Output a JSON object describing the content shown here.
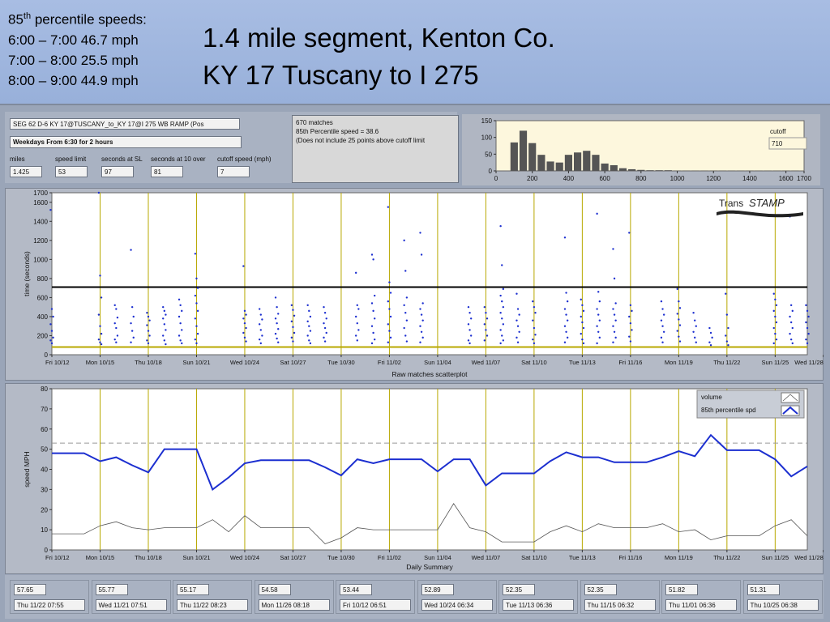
{
  "header": {
    "pct_title_base": "85",
    "pct_title_sup": "th",
    "pct_title_rest": " percentile speeds:",
    "pct_lines": [
      "6:00 – 7:00 46.7 mph",
      "7:00 – 8:00 25.5 mph",
      "8:00 – 9:00 44.9 mph"
    ],
    "title_line1": "1.4 mile segment, Kenton Co.",
    "title_line2": "KY 17   Tuscany to I 275"
  },
  "controls": {
    "segment": "SEG 62  D-6   KY 17@TUSCANY_to_KY 17@I 275 WB RAMP  (Pos",
    "period": "Weekdays   From 6:30 for  2 hours",
    "miles_label": "miles",
    "miles_value": "1.425",
    "speed_limit_label": "speed limit",
    "speed_limit_value": "53",
    "sec_sl_label": "seconds at SL",
    "sec_sl_value": "97",
    "sec_10_label": "seconds at 10 over",
    "sec_10_value": "81",
    "cutoff_label": "cutoff speed (mph)",
    "cutoff_value": "7"
  },
  "info": {
    "line1": "670 matches",
    "line2": "85th Percentile speed = 38.6",
    "line3": "(Does not include 25 points above cutoff limit"
  },
  "histogram": {
    "cutoff_label": "cutoff",
    "cutoff_value": "710"
  },
  "logo": {
    "text_a": "Trans",
    "text_b": "STAMP"
  },
  "scatter_caption": "Raw matches scatterplot",
  "scatter_ylabel": "time (seconds)",
  "daily_caption": "Daily Summary",
  "daily_ylabel": "speed MPH",
  "legend": {
    "volume": "volume",
    "pct": "85th percentile spd"
  },
  "bottom_cells": [
    {
      "value": "57.65",
      "date": "Thu 11/22  07:55"
    },
    {
      "value": "55.77",
      "date": "Wed 11/21  07:51"
    },
    {
      "value": "55.17",
      "date": "Thu 11/22  08:23"
    },
    {
      "value": "54.58",
      "date": "Mon 11/26  08:18"
    },
    {
      "value": "53.44",
      "date": "Fri 10/12  06:51"
    },
    {
      "value": "52.89",
      "date": "Wed 10/24  06:34"
    },
    {
      "value": "52.35",
      "date": "Tue 11/13  06:36"
    },
    {
      "value": "52.35",
      "date": "Thu 11/15  06:32"
    },
    {
      "value": "51.82",
      "date": "Thu 11/01  06:36"
    },
    {
      "value": "51.31",
      "date": "Thu 10/25  06:38"
    }
  ],
  "chart_data": [
    {
      "type": "bar",
      "name": "histogram",
      "xlim": [
        0,
        1700
      ],
      "ylim": [
        0,
        150
      ],
      "xticks": [
        "0",
        "200",
        "400",
        "600",
        "800",
        "1000",
        "1200",
        "1400",
        "1600",
        "1700"
      ],
      "yticks": [
        "0",
        "50",
        "100",
        "150"
      ],
      "bin_width": 50,
      "x": [
        100,
        150,
        200,
        250,
        300,
        350,
        400,
        450,
        500,
        550,
        600,
        650,
        700,
        750,
        800,
        850,
        900,
        950,
        1000,
        1050,
        1100,
        1150,
        1200,
        1250,
        1300,
        1350,
        1400,
        1450,
        1500,
        1550,
        1600,
        1650
      ],
      "values": [
        85,
        120,
        83,
        48,
        28,
        25,
        48,
        55,
        60,
        48,
        22,
        17,
        8,
        5,
        3,
        2,
        2,
        2,
        1,
        1,
        1,
        1,
        1,
        1,
        1,
        1,
        1,
        1,
        1,
        1,
        1,
        1
      ],
      "color": "#555555"
    },
    {
      "type": "scatter",
      "name": "raw-matches",
      "title": "Raw matches scatterplot",
      "ylabel": "time (seconds)",
      "xlim": [
        0,
        47
      ],
      "ylim": [
        0,
        1700
      ],
      "yticks": [
        "0",
        "200",
        "400",
        "600",
        "800",
        "1000",
        "1200",
        "1400",
        "1600",
        "1700"
      ],
      "xticks": [
        "Fri 10/12",
        "Mon 10/15",
        "Thu 10/18",
        "Sun 10/21",
        "Wed 10/24",
        "Sat 10/27",
        "Tue 10/30",
        "Fri 11/02",
        "Sun 11/04",
        "Wed 11/07",
        "Sat 11/10",
        "Tue 11/13",
        "Fri 11/16",
        "Mon 11/19",
        "Thu 11/22",
        "Sun 11/25",
        "Wed 11/28"
      ],
      "cutoff_line": 710,
      "free_flow_line": 81,
      "point_color": "#1c2fd0",
      "daily": [
        {
          "day": 0,
          "times": [
            1520,
            480,
            400,
            320,
            250,
            180,
            150,
            120
          ]
        },
        {
          "day": 3,
          "times": [
            1700,
            830,
            600,
            420,
            300,
            220,
            160,
            130,
            110
          ]
        },
        {
          "day": 4,
          "times": [
            520,
            480,
            390,
            330,
            280,
            200,
            160,
            130
          ]
        },
        {
          "day": 5,
          "times": [
            1100,
            500,
            400,
            330,
            250,
            180,
            130
          ]
        },
        {
          "day": 6,
          "times": [
            440,
            400,
            360,
            310,
            250,
            200,
            150,
            120
          ]
        },
        {
          "day": 7,
          "times": [
            500,
            460,
            420,
            380,
            320,
            260,
            200,
            150,
            110
          ]
        },
        {
          "day": 8,
          "times": [
            580,
            520,
            460,
            400,
            330,
            260,
            200,
            150,
            120
          ]
        },
        {
          "day": 9,
          "times": [
            1060,
            800,
            700,
            620,
            540,
            460,
            380,
            300,
            220,
            160,
            120
          ]
        },
        {
          "day": 12,
          "times": [
            930,
            460,
            420,
            380,
            330,
            280,
            230,
            180,
            140
          ]
        },
        {
          "day": 13,
          "times": [
            480,
            420,
            370,
            320,
            260,
            200,
            160,
            120
          ]
        },
        {
          "day": 14,
          "times": [
            600,
            500,
            430,
            380,
            330,
            270,
            220,
            170,
            130
          ]
        },
        {
          "day": 15,
          "times": [
            520,
            470,
            410,
            350,
            290,
            230,
            180,
            140
          ]
        },
        {
          "day": 16,
          "times": [
            520,
            460,
            400,
            350,
            300,
            250,
            200,
            150,
            120
          ]
        },
        {
          "day": 17,
          "times": [
            500,
            440,
            380,
            330,
            280,
            230,
            180,
            140
          ]
        },
        {
          "day": 19,
          "times": [
            860,
            520,
            480,
            400,
            330,
            260,
            200,
            150
          ]
        },
        {
          "day": 20,
          "times": [
            1050,
            1000,
            620,
            540,
            460,
            380,
            300,
            230,
            160,
            120
          ]
        },
        {
          "day": 21,
          "times": [
            1550,
            760,
            650,
            560,
            480,
            400,
            320,
            250,
            180,
            130
          ]
        },
        {
          "day": 22,
          "times": [
            1200,
            880,
            600,
            520,
            440,
            360,
            280,
            200,
            140
          ]
        },
        {
          "day": 23,
          "times": [
            1280,
            1050,
            540,
            480,
            420,
            360,
            300,
            240,
            180,
            130
          ]
        },
        {
          "day": 26,
          "times": [
            500,
            440,
            380,
            320,
            260,
            200,
            150,
            120
          ]
        },
        {
          "day": 27,
          "times": [
            500,
            440,
            380,
            320,
            260,
            200,
            150
          ]
        },
        {
          "day": 28,
          "times": [
            1350,
            940,
            690,
            620,
            560,
            500,
            440,
            380,
            320,
            260,
            200,
            150,
            120
          ]
        },
        {
          "day": 29,
          "times": [
            640,
            480,
            420,
            360,
            300,
            240,
            180,
            130
          ]
        },
        {
          "day": 30,
          "times": [
            560,
            500,
            440,
            360,
            280,
            210,
            160,
            120
          ]
        },
        {
          "day": 32,
          "times": [
            1230,
            650,
            560,
            480,
            420,
            360,
            300,
            240,
            180,
            130
          ]
        },
        {
          "day": 33,
          "times": [
            580,
            520,
            460,
            400,
            340,
            280,
            220,
            160,
            120
          ]
        },
        {
          "day": 34,
          "times": [
            1480,
            660,
            560,
            480,
            420,
            360,
            300,
            240,
            180,
            120
          ]
        },
        {
          "day": 35,
          "times": [
            1110,
            800,
            540,
            480,
            420,
            360,
            300,
            240,
            180,
            130
          ]
        },
        {
          "day": 36,
          "times": [
            1280,
            520,
            460,
            400,
            330,
            260,
            190,
            140
          ]
        },
        {
          "day": 38,
          "times": [
            560,
            480,
            420,
            360,
            300,
            240,
            180,
            130
          ]
        },
        {
          "day": 39,
          "times": [
            690,
            560,
            490,
            430,
            370,
            310,
            250,
            190,
            140
          ]
        },
        {
          "day": 40,
          "times": [
            440,
            360,
            300,
            240,
            180,
            130
          ]
        },
        {
          "day": 41,
          "times": [
            280,
            230,
            180,
            130,
            100
          ]
        },
        {
          "day": 42,
          "times": [
            640,
            420,
            280,
            200,
            140,
            100
          ]
        },
        {
          "day": 45,
          "times": [
            640,
            580,
            520,
            460,
            400,
            340,
            280,
            220,
            160,
            120
          ]
        },
        {
          "day": 46,
          "times": [
            1450,
            520,
            460,
            400,
            340,
            280,
            220,
            160,
            120
          ]
        },
        {
          "day": 47,
          "times": [
            520,
            460,
            400,
            340,
            280,
            220,
            160,
            120
          ]
        }
      ]
    },
    {
      "type": "line",
      "name": "daily-summary",
      "title": "Daily Summary",
      "ylabel": "speed MPH",
      "xlim": [
        0,
        47
      ],
      "ylim": [
        0,
        80
      ],
      "yticks": [
        "0",
        "10",
        "20",
        "30",
        "40",
        "50",
        "60",
        "70",
        "80"
      ],
      "xticks": [
        "Fri 10/12",
        "Mon 10/15",
        "Thu 10/18",
        "Sun 10/21",
        "Wed 10/24",
        "Sat 10/27",
        "Tue 10/30",
        "Fri 11/02",
        "Sun 11/04",
        "Wed 11/07",
        "Sat 11/10",
        "Tue 11/13",
        "Fri 11/16",
        "Mon 11/19",
        "Thu 11/22",
        "Sun 11/25",
        "Wed 11/28"
      ],
      "speed_limit_line": 53,
      "legend": "top-right",
      "series": [
        {
          "name": "85th percentile spd",
          "color": "#1c2fd0",
          "x": [
            0,
            1,
            2,
            3,
            4,
            5,
            6,
            7,
            8,
            9,
            10,
            11,
            12,
            13,
            14,
            15,
            16,
            17,
            18,
            19,
            20,
            21,
            22,
            23,
            24,
            25,
            26,
            27,
            28,
            29,
            30,
            31,
            32,
            33,
            34,
            35,
            36,
            37,
            38,
            39,
            40,
            41,
            42,
            43,
            44,
            45,
            46,
            47
          ],
          "values": [
            48,
            48,
            48,
            44,
            46,
            42,
            38.5,
            50,
            50,
            50,
            30,
            36,
            43,
            44.5,
            44.5,
            44.5,
            44.5,
            41,
            37,
            45,
            43,
            45,
            45,
            45,
            39,
            45,
            45,
            32,
            38,
            38,
            38,
            44,
            48.5,
            46,
            46,
            43.5,
            43.5,
            43.5,
            46,
            49,
            46.5,
            57,
            49.5,
            49.5,
            49.5,
            45,
            36.5,
            41.5
          ]
        },
        {
          "name": "volume",
          "color": "#555555",
          "x": [
            0,
            1,
            2,
            3,
            4,
            5,
            6,
            7,
            8,
            9,
            10,
            11,
            12,
            13,
            14,
            15,
            16,
            17,
            18,
            19,
            20,
            21,
            22,
            23,
            24,
            25,
            26,
            27,
            28,
            29,
            30,
            31,
            32,
            33,
            34,
            35,
            36,
            37,
            38,
            39,
            40,
            41,
            42,
            43,
            44,
            45,
            46,
            47
          ],
          "values": [
            8,
            8,
            8,
            12,
            14,
            11,
            10,
            11,
            11,
            11,
            15,
            9,
            17,
            11,
            11,
            11,
            11,
            3,
            6,
            11,
            10,
            10,
            10,
            10,
            10,
            23,
            11,
            9,
            4,
            4,
            4,
            9,
            12,
            9,
            13,
            11,
            11,
            11,
            13,
            9,
            10,
            5,
            7,
            7,
            7,
            12,
            15,
            7
          ]
        }
      ]
    }
  ]
}
